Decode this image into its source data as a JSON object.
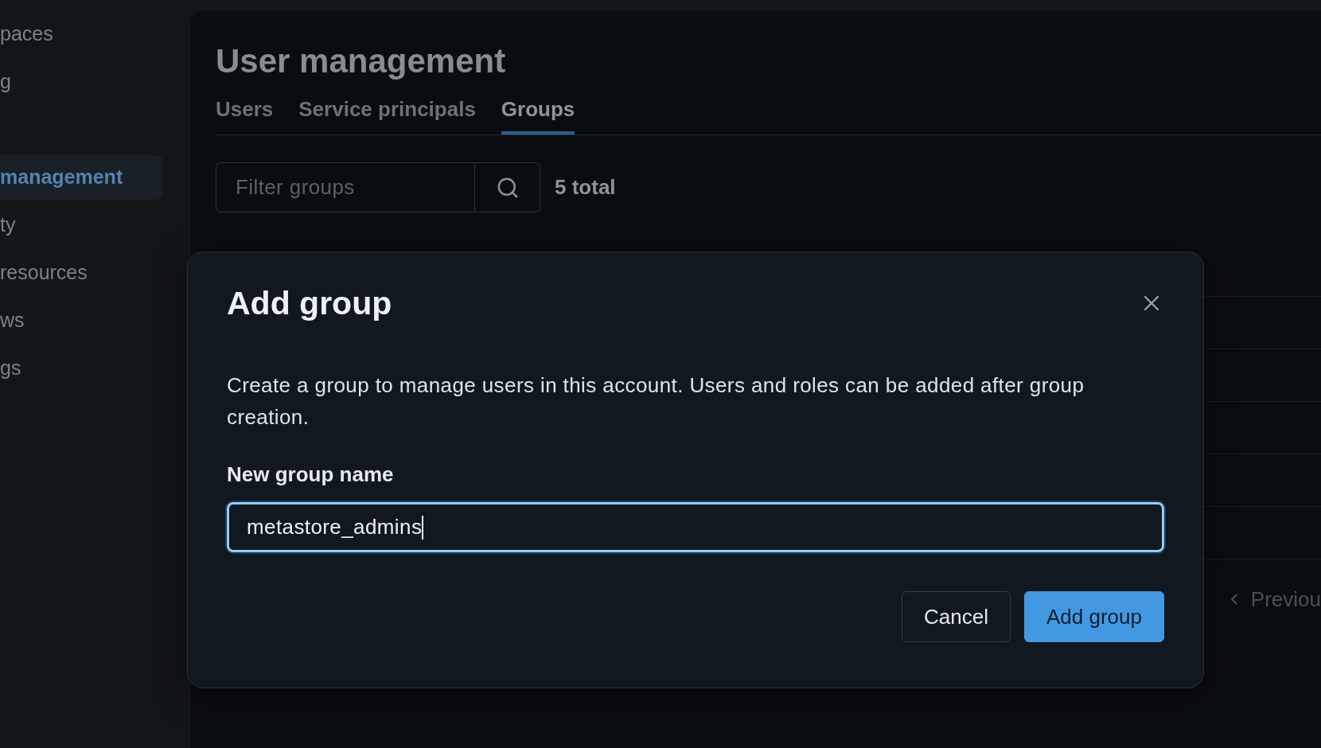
{
  "sidebar": {
    "sections": [
      {
        "items": [
          {
            "label": "paces",
            "selected": false
          },
          {
            "label": "g",
            "selected": false
          }
        ]
      },
      {
        "items": [
          {
            "label": "management",
            "selected": true
          },
          {
            "label": "ty",
            "selected": false
          },
          {
            "label": "resources",
            "selected": false
          },
          {
            "label": "ws",
            "selected": false
          },
          {
            "label": "gs",
            "selected": false
          }
        ]
      }
    ]
  },
  "page": {
    "title": "User management",
    "tabs": [
      {
        "label": "Users",
        "selected": false
      },
      {
        "label": "Service principals",
        "selected": false
      },
      {
        "label": "Groups",
        "selected": true
      }
    ],
    "filter": {
      "placeholder": "Filter groups"
    },
    "count": "5 total",
    "pagination": {
      "previous": "Previou"
    }
  },
  "dialog": {
    "title": "Add group",
    "description": "Create a group to manage users in this account. Users and roles can be added after group creation.",
    "field": {
      "label": "New group name",
      "value": "metastore_admins",
      "focused": true
    },
    "buttons": [
      {
        "label": "Cancel",
        "kind": "secondary"
      },
      {
        "label": "Add group",
        "kind": "primary"
      }
    ]
  }
}
